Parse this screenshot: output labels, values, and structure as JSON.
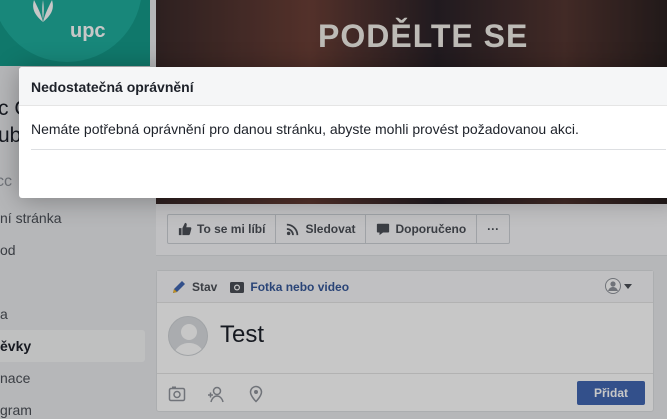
{
  "cover": {
    "headline": "PODĚLTE SE"
  },
  "logo": {
    "text": "upc"
  },
  "page": {
    "name_line1": "c Č",
    "name_line2": "ubl",
    "handle": "cc"
  },
  "sidebar": {
    "items": [
      {
        "label": "ní stránka"
      },
      {
        "label": "od"
      },
      {
        "label": ""
      },
      {
        "label": "a"
      },
      {
        "label": "ěvky"
      },
      {
        "label": "nace"
      },
      {
        "label": "gram"
      }
    ]
  },
  "action_bar": {
    "like_label": "To se mi líbí",
    "follow_label": "Sledovat",
    "recommend_label": "Doporučeno",
    "more_label": "···"
  },
  "composer": {
    "tab_status": "Stav",
    "tab_photo": "Fotka nebo video",
    "text": "Test",
    "post_button": "Přidat"
  },
  "dialog": {
    "title": "Nedostatečná oprávnění",
    "message": "Nemáte potřebná oprávnění pro danou stránku, abyste mohli provést požadovanou akci."
  },
  "colors": {
    "accent": "#4267b2",
    "link": "#365899",
    "brand": "#159a8a"
  }
}
